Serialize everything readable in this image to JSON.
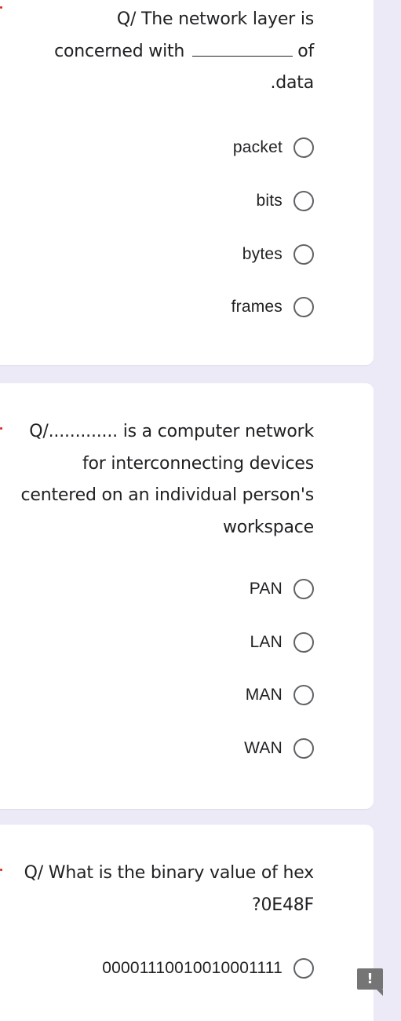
{
  "questions": [
    {
      "required": true,
      "text_lines": [
        "Q/ The network layer  is",
        "concerned with",
        "of",
        ".data"
      ],
      "options": [
        "packet",
        "bits",
        "bytes",
        "frames"
      ]
    },
    {
      "required": true,
      "text_lines": [
        "Q/............. is a computer network",
        "for interconnecting devices",
        "centered on an individual person's",
        "workspace"
      ],
      "options": [
        "PAN",
        "LAN",
        "MAN",
        "WAN"
      ]
    },
    {
      "required": true,
      "text_lines": [
        "Q/  What is the binary value of hex",
        "?0E48F"
      ],
      "options": [
        "00001110010010001111"
      ]
    }
  ],
  "feedback_button": {
    "icon": "exclamation-icon",
    "glyph": "!"
  },
  "colors": {
    "background": "#ECEAF6",
    "card": "#FFFFFF",
    "text": "#202124",
    "radio_border": "#5F6368",
    "required": "#D93025",
    "feedback": "#757575"
  }
}
